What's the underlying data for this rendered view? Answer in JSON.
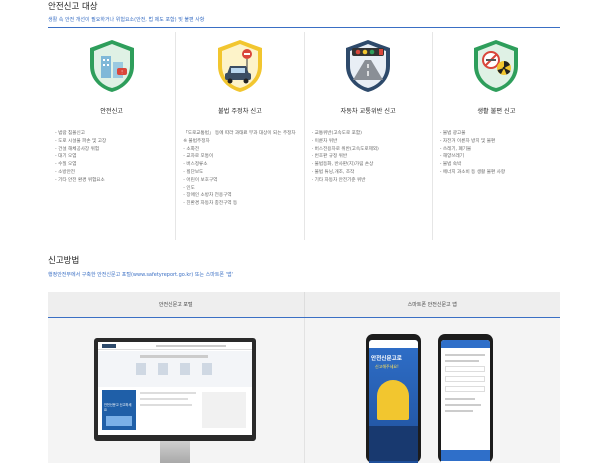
{
  "section1": {
    "title": "안전신고 대상",
    "subtitle": "생활 속 안전 개선이 필요하거나 위험요소(안전, 법 제도 포함) 및 불편 사항"
  },
  "columns": [
    {
      "icon": "building-hazard-icon",
      "title": "안전신고",
      "items": [
        "- 범람 침몰신고",
        "- 도로 시설물 파손 및 고장",
        "- 건설 해체공사장 위험",
        "- 대기 오염",
        "- 수질 오염",
        "- 소방안전",
        "- 기타 안전 환경 위험요소"
      ]
    },
    {
      "icon": "parked-car-icon",
      "title": "불법 주정차 신고",
      "items": [
        "「도로교통법」 등에 따라 과태료 부과 대상이 되는 주정차",
        "※ 불법주정차",
        "  - 소화전",
        "  - 교차로 모퉁이",
        "  - 버스정류소",
        "  - 횡단보도",
        "  - 어린이 보호구역",
        "  - 인도",
        "- 장애인 소방차 전용구역",
        "- 친환경 자동차 충전구역 등"
      ]
    },
    {
      "icon": "traffic-light-icon",
      "title": "자동차 교통위반 신고",
      "items": [
        "- 교통위반(고속도로 포함)",
        "- 이륜차 위반",
        "- 버스전용차로 위반(고속도로제외)",
        "- 번호판 규정 위반",
        "- 불법등화, 반사판(지)가림 손상",
        "- 불법 튜닝,개조, 조작",
        "- 기타 자동차 안전기준 위반"
      ]
    },
    {
      "icon": "no-smoking-icon",
      "title": "생활 불편 신고",
      "items": [
        "- 불법 광고물",
        "- 자전거 이륜차 방치 및 불편",
        "- 쓰레기, 폐기물",
        "- 해양쓰레기",
        "- 불법 숙박",
        "- 에너지 과소비 등 생활 불편 사항"
      ]
    }
  ],
  "section2": {
    "title": "신고방법",
    "subtitle": "행정안전부에서 구축한 안전신문고 포털(www.safetyreport.go.kr) 또는 스마트폰 '앱'"
  },
  "method": {
    "portal_label": "안전신문고 포털",
    "app_label": "스마트폰 안전신문고 앱",
    "portal_banner": "안전신문고 신고하세요",
    "app_banner_line1": "안전신문고로",
    "app_banner_line2": "신고해주세요!"
  },
  "colors": {
    "accent": "#3a6fc4",
    "shield_green": "#2e9e5b",
    "shield_yellow": "#f2c62f",
    "shield_dark": "#2e4a6b"
  }
}
